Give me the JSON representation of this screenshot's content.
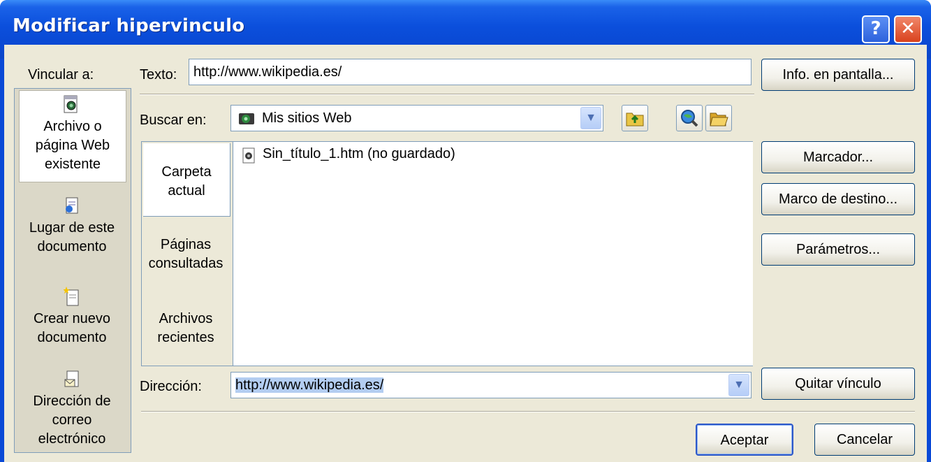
{
  "window": {
    "title": "Modificar hipervinculo",
    "help_glyph": "?",
    "close_glyph": "✕"
  },
  "sidebar": {
    "heading": "Vincular a:",
    "items": [
      {
        "lines": [
          "Archivo o",
          "página Web",
          "existente"
        ],
        "icon": "web-page-icon",
        "selected": true
      },
      {
        "lines": [
          "Lugar de este",
          "documento"
        ],
        "icon": "document-place-icon",
        "selected": false
      },
      {
        "lines": [
          "Crear nuevo",
          "documento"
        ],
        "icon": "new-document-icon",
        "selected": false
      },
      {
        "lines": [
          "Dirección de",
          "correo",
          "electrónico"
        ],
        "icon": "email-document-icon",
        "selected": false
      }
    ]
  },
  "texto": {
    "label": "Texto:",
    "value": "http://www.wikipedia.es/"
  },
  "buscar": {
    "label": "Buscar en:",
    "value": "Mis sitios Web"
  },
  "tabs": [
    {
      "lines": [
        "Carpeta",
        "actual"
      ],
      "selected": true
    },
    {
      "lines": [
        "Páginas",
        "consultadas"
      ],
      "selected": false
    },
    {
      "lines": [
        "Archivos",
        "recientes"
      ],
      "selected": false
    }
  ],
  "files": [
    {
      "name": "Sin_título_1.htm (no guardado)"
    }
  ],
  "direccion": {
    "label": "Dirección:",
    "value": "http://www.wikipedia.es/"
  },
  "buttons": {
    "info": "Info. en pantalla...",
    "marcador": "Marcador...",
    "marco": "Marco de destino...",
    "parametros": "Parámetros...",
    "quitar": "Quitar vínculo",
    "aceptar": "Aceptar",
    "cancelar": "Cancelar"
  },
  "colors": {
    "title_bar": "#0a49d6",
    "dialog_bg": "#ece9d8",
    "selection": "#b3cdf1",
    "close_button": "#d9421d"
  }
}
